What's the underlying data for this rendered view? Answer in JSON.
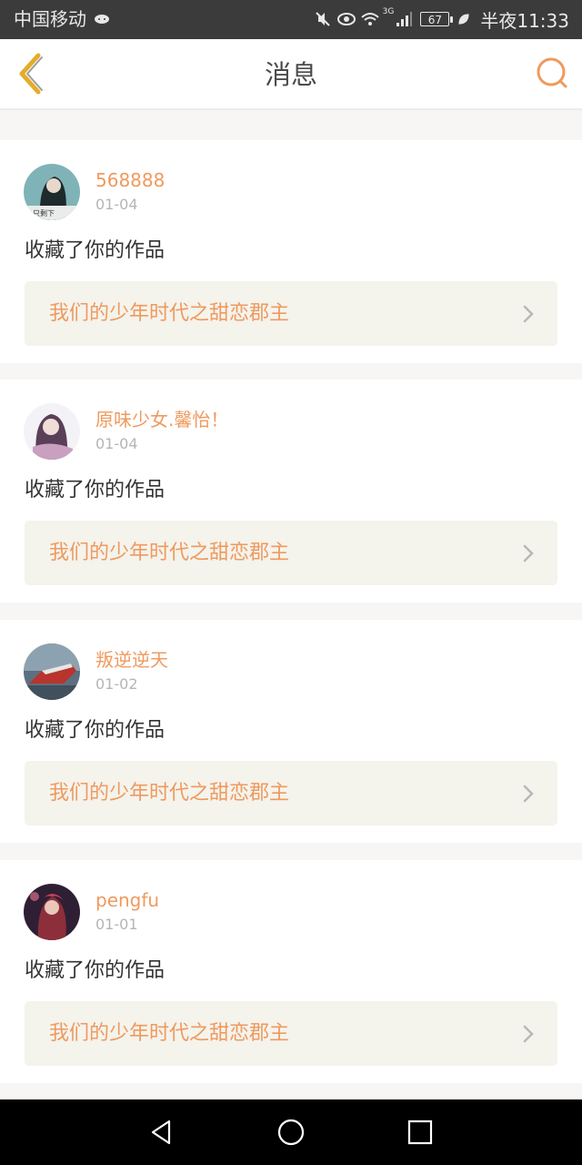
{
  "status_bar": {
    "carrier": "中国移动",
    "battery": "67",
    "time": "半夜11:33",
    "network": "3G",
    "icons": [
      "cat-icon",
      "mute-icon",
      "eye-icon",
      "wifi-icon",
      "signal-icon",
      "battery-icon",
      "leaf-icon"
    ]
  },
  "header": {
    "title": "消息",
    "back_icon": "chevron-left-icon",
    "search_icon": "search-icon"
  },
  "colors": {
    "accent": "#ef9a5e",
    "back": "#e5ac2a",
    "status_bg": "#3b3b3b",
    "work_bg": "#f4f3ec"
  },
  "messages": [
    {
      "name": "568888",
      "date": "01-04",
      "action": "收藏了你的作品",
      "work_title": "我们的少年时代之甜恋郡主"
    },
    {
      "name": "原味少女.馨怡！",
      "date": "01-04",
      "action": "收藏了你的作品",
      "work_title": "我们的少年时代之甜恋郡主"
    },
    {
      "name": "叛逆逆天",
      "date": "01-02",
      "action": "收藏了你的作品",
      "work_title": "我们的少年时代之甜恋郡主"
    },
    {
      "name": "pengfu",
      "date": "01-01",
      "action": "收藏了你的作品",
      "work_title": "我们的少年时代之甜恋郡主"
    }
  ],
  "nav_bar": {
    "icons": [
      "back-triangle-icon",
      "home-circle-icon",
      "recents-square-icon"
    ]
  }
}
